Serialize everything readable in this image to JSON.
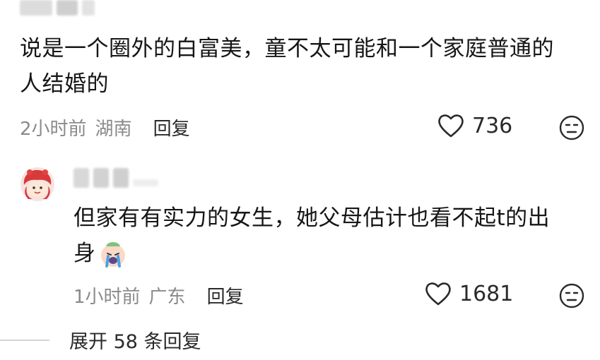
{
  "comment1": {
    "text_line1": "说是一个圈外的白富美，童不太可能和一个家庭普通的",
    "text_line2": "人结婚的",
    "time": "2小时前",
    "location": "湖南",
    "reply_label": "回复",
    "likes": "736"
  },
  "comment2": {
    "text_line1": "但家有有实力的女生，她父母估计也看不起t的出",
    "text_line2": "身",
    "time": "1小时前",
    "location": "广东",
    "reply_label": "回复",
    "likes": "1681"
  },
  "expand": {
    "label": "展开 58 条回复"
  },
  "icons": {
    "like": "heart-outline-icon",
    "react": "neutral-face-icon",
    "inline_emoji": "crying-emoji-icon",
    "avatar": "cartoon-avatar"
  },
  "colors": {
    "text": "#161616",
    "meta": "#8a8a8a",
    "avatar_red": "#d83a3a"
  }
}
